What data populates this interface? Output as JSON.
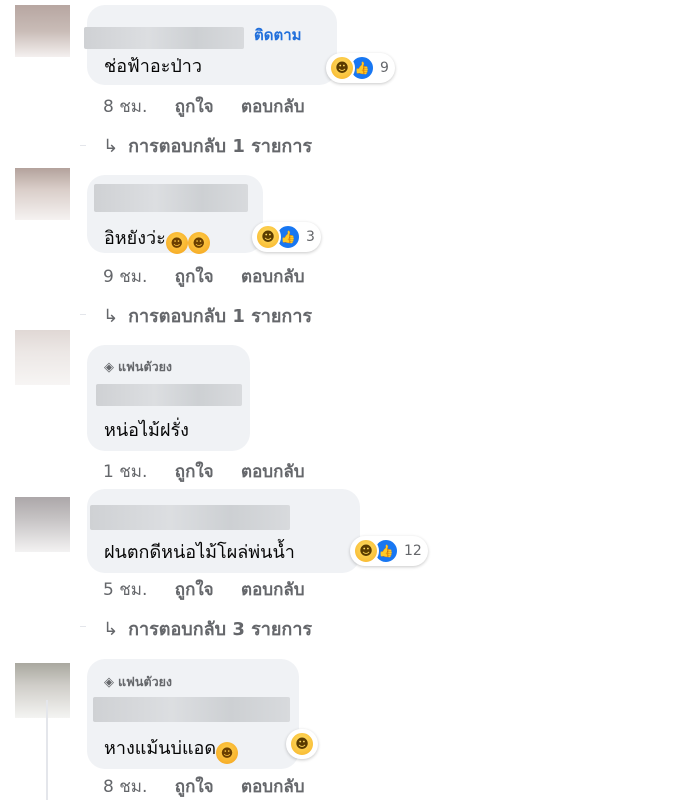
{
  "comments": [
    {
      "follow_label": "ติดตาม",
      "text": "ช่อฟ้าอะป่าว",
      "reaction_count": "9",
      "time": "8 ชม.",
      "like": "ถูกใจ",
      "reply": "ตอบกลับ",
      "replies_label": "การตอบกลับ 1 รายการ"
    },
    {
      "text": "อิหยังว่ะ",
      "reaction_count": "3",
      "time": "9 ชม.",
      "like": "ถูกใจ",
      "reply": "ตอบกลับ",
      "replies_label": "การตอบกลับ 1 รายการ"
    },
    {
      "badge": "แฟนตัวยง",
      "text": "หน่อไม้ฝรั่ง",
      "time": "1 ชม.",
      "like": "ถูกใจ",
      "reply": "ตอบกลับ"
    },
    {
      "text": "ฝนตกดีหน่อไม้โผล่พ่นน้ำ",
      "reaction_count": "12",
      "time": "5 ชม.",
      "like": "ถูกใจ",
      "reply": "ตอบกลับ",
      "replies_label": "การตอบกลับ 3 รายการ"
    },
    {
      "badge": "แฟนตัวยง",
      "text": "หางแม้นบ่แอด",
      "time": "8 ชม.",
      "like": "ถูกใจ",
      "reply": "ตอบกลับ"
    }
  ],
  "icons": {
    "haha": "haha-reaction-icon",
    "like": "like-reaction-icon",
    "reply_arrow": "reply-arrow-icon",
    "badge": "diamond-icon"
  },
  "colors": {
    "bubble": "#f0f2f5",
    "link": "#216fdb",
    "meta": "#65676b",
    "like_blue": "#1877f2"
  }
}
